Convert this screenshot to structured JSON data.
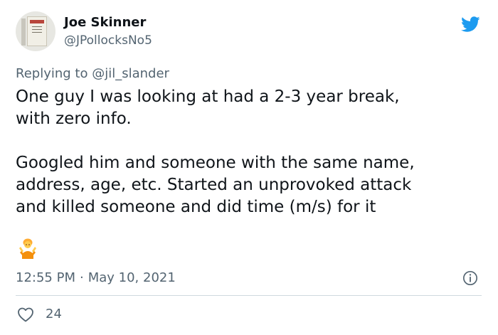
{
  "author": {
    "name": "Joe Skinner",
    "handle": "@JPollocksNo5"
  },
  "reply": {
    "prefix": "Replying to ",
    "mention": "@jil_slander"
  },
  "tweet": {
    "text": "One guy I was looking at had a 2-3 year break,\nwith zero info.\n\nGoogled him and someone with the same name,\naddress, age, etc. Started an unprovoked attack\nand killed someone and did time (m/s) for it"
  },
  "meta": {
    "time": "12:55 PM",
    "separator": "·",
    "date": "May 10, 2021"
  },
  "stats": {
    "likes": "24"
  },
  "icons": {
    "brand": "twitter-bird-icon",
    "emoji": "person-shrugging-emoji",
    "info": "info-icon",
    "like": "heart-icon"
  },
  "colors": {
    "brand": "#1d9bf0",
    "text": "#0f1419",
    "secondary": "#536471",
    "divider": "#cfd9de"
  }
}
